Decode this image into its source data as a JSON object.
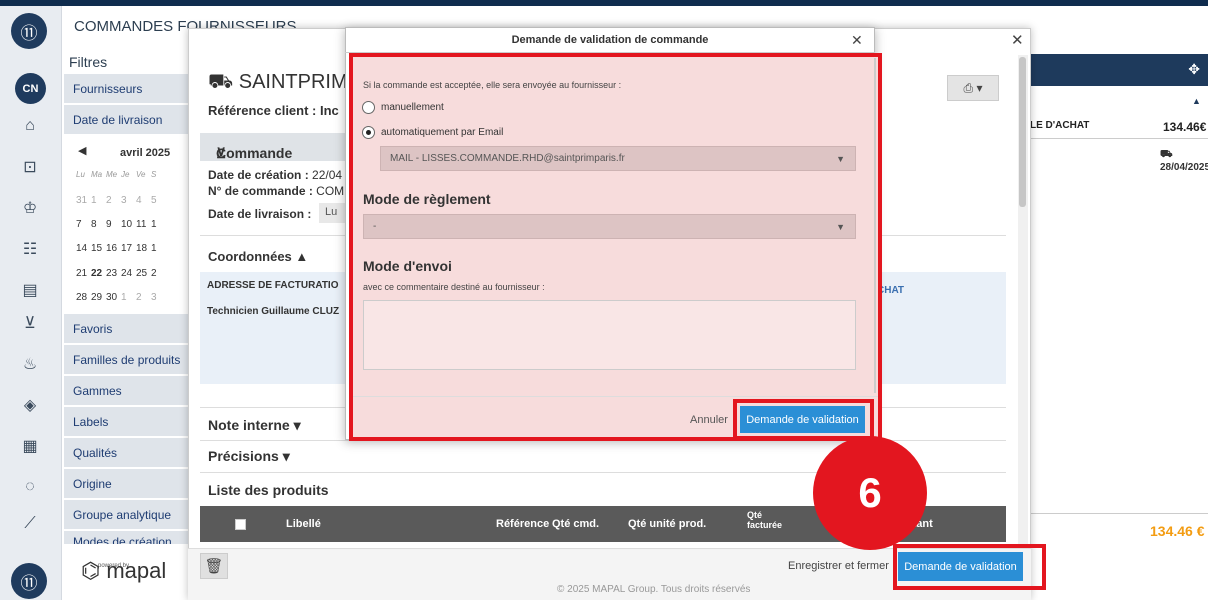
{
  "app": {
    "logo_icon": "fork-knife-logo",
    "avatar": "CN",
    "page_title": "COMMANDES FOURNISSEURS"
  },
  "filters": {
    "title": "Filtres",
    "items": [
      "Fournisseurs",
      "Date de livraison",
      "Favoris",
      "Familles de produits",
      "Gammes",
      "Labels",
      "Qualités",
      "Origine",
      "Groupe analytique",
      "Modes de création"
    ],
    "calendar": {
      "month": "avril 2025",
      "weekdays": [
        "Lu",
        "Ma",
        "Me",
        "Je",
        "Ve",
        "S"
      ],
      "rows": [
        [
          "31",
          "1",
          "2",
          "3",
          "4",
          "5"
        ],
        [
          "7",
          "8",
          "9",
          "10",
          "11",
          "1"
        ],
        [
          "14",
          "15",
          "16",
          "17",
          "18",
          "1"
        ],
        [
          "21",
          "22",
          "23",
          "24",
          "25",
          "2"
        ],
        [
          "28",
          "29",
          "30",
          "1",
          "2",
          "3"
        ]
      ],
      "selected": "22"
    },
    "powered_by": "powered by",
    "brand": "mapal"
  },
  "background": {
    "total_label": "LE D'ACHAT",
    "total_value": "134.46€",
    "delivery_date": "28/04/2025",
    "grand_total": "134.46 €"
  },
  "order_panel": {
    "supplier": "SAINTPRIM",
    "client_ref": "Référence client : Inc",
    "section_title": "Commande",
    "creation_date_label": "Date de création :",
    "creation_date_value": "22/04",
    "order_number_label": "N° de commande :",
    "order_number_value": "COM",
    "delivery_label": "Date de livraison :",
    "delivery_value": "Lu",
    "coordinates": "Coordonnées ▲",
    "billing_address": "ADRESSE DE FACTURATIO",
    "technician": "Technicien Guillaume CLUZ",
    "purchase_hint": "CHAT",
    "internal_note": "Note interne ▾",
    "details": "Précisions ▾",
    "products": "Liste des produits",
    "columns": {
      "label": "Libellé",
      "ref": "Référence",
      "qty_ordered": "Qté cmd.",
      "qty_unit": "Qté unité prod.",
      "qty_billed": "Qté facturée",
      "amount": "Montant"
    },
    "save_close": "Enregistrer et fermer",
    "validation_button": "Demande de validation",
    "footer": "© 2025 MAPAL Group. Tous droits réservés"
  },
  "modal": {
    "title": "Demande de validation de commande",
    "intro": "Si la commande est acceptée, elle sera envoyée au fournisseur :",
    "option_manual": "manuellement",
    "option_email": "automatiquement par Email",
    "email_value": "MAIL - LISSES.COMMANDE.RHD@saintprimparis.fr",
    "payment_heading": "Mode de règlement",
    "payment_value": "-",
    "shipping_heading": "Mode d'envoi",
    "shipping_note": "avec ce commentaire destiné au fournisseur :",
    "comment_value": "",
    "cancel": "Annuler",
    "submit": "Demande de validation"
  },
  "annotation": {
    "step": "6",
    "color": "#e3161f"
  }
}
